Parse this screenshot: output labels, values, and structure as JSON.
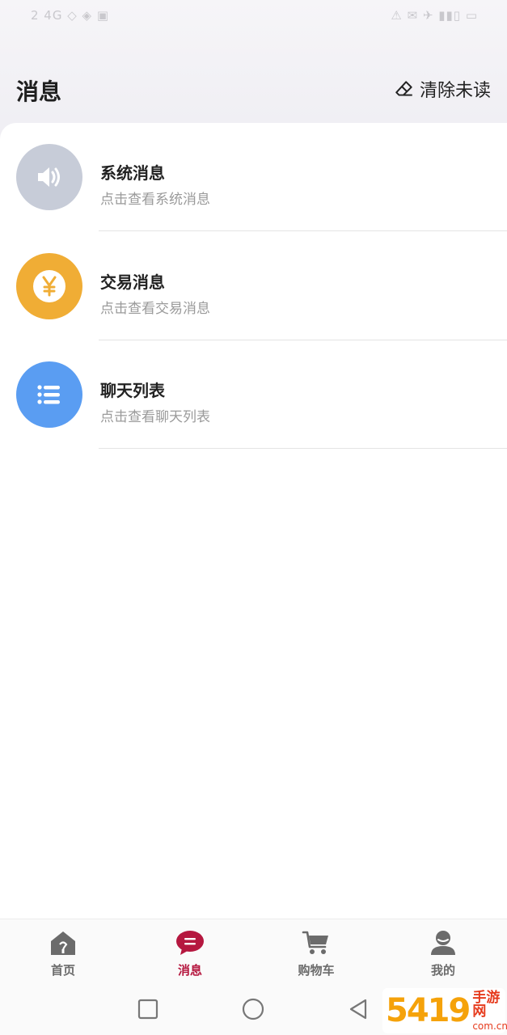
{
  "status_bar": {
    "left": "2 4G ◇ ◈ ▣",
    "right": "⚠ ✉ ✈ ▮▮▯ ▭"
  },
  "header": {
    "title": "消息",
    "clear_unread": "清除未读"
  },
  "messages": [
    {
      "title": "系统消息",
      "subtitle": "点击查看系统消息",
      "icon": "speaker-icon",
      "color": "#c4cad8"
    },
    {
      "title": "交易消息",
      "subtitle": "点击查看交易消息",
      "icon": "yen-icon",
      "color": "#f0ad35"
    },
    {
      "title": "聊天列表",
      "subtitle": "点击查看聊天列表",
      "icon": "list-icon",
      "color": "#5a9df2"
    }
  ],
  "tabs": [
    {
      "label": "首页",
      "icon": "home-icon",
      "active": false
    },
    {
      "label": "消息",
      "icon": "message-icon",
      "active": true
    },
    {
      "label": "购物车",
      "icon": "cart-icon",
      "active": false
    },
    {
      "label": "我的",
      "icon": "user-icon",
      "active": false
    }
  ],
  "colors": {
    "accent": "#b5173f",
    "tab_inactive": "#6b6b6b"
  },
  "watermark": {
    "number": "5419",
    "text": "手游网",
    "domain": "com.cn"
  }
}
